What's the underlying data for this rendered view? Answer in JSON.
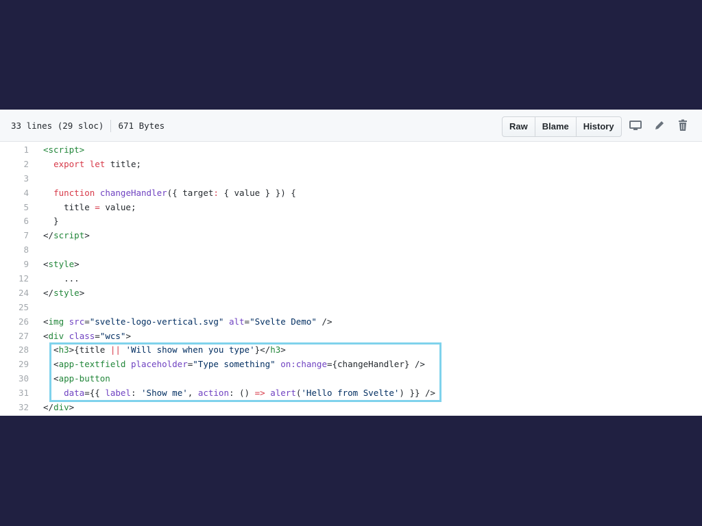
{
  "file_header": {
    "lines_info": "33 lines (29 sloc)",
    "size_info": "671 Bytes",
    "buttons": [
      "Raw",
      "Blame",
      "History"
    ],
    "icons": [
      "desktop-icon",
      "pencil-icon",
      "trash-icon"
    ]
  },
  "code_lines": [
    {
      "n": "1",
      "tokens": [
        [
          "tag",
          "<script>"
        ]
      ]
    },
    {
      "n": "2",
      "tokens": [
        [
          "plain",
          "  "
        ],
        [
          "kw",
          "export"
        ],
        [
          "plain",
          " "
        ],
        [
          "kw",
          "let"
        ],
        [
          "plain",
          " title;"
        ]
      ]
    },
    {
      "n": "3",
      "tokens": []
    },
    {
      "n": "4",
      "tokens": [
        [
          "plain",
          "  "
        ],
        [
          "kw",
          "function"
        ],
        [
          "plain",
          " "
        ],
        [
          "fn",
          "changeHandler"
        ],
        [
          "plain",
          "({ target"
        ],
        [
          "kw",
          ":"
        ],
        [
          "plain",
          " { value } }) {"
        ]
      ]
    },
    {
      "n": "5",
      "tokens": [
        [
          "plain",
          "    title "
        ],
        [
          "kw",
          "="
        ],
        [
          "plain",
          " value;"
        ]
      ]
    },
    {
      "n": "6",
      "tokens": [
        [
          "plain",
          "  }"
        ]
      ]
    },
    {
      "n": "7",
      "tokens": [
        [
          "plain",
          "</"
        ],
        [
          "tag",
          "script"
        ],
        [
          "plain",
          ">"
        ]
      ]
    },
    {
      "n": "8",
      "tokens": []
    },
    {
      "n": "9",
      "tokens": [
        [
          "plain",
          "<"
        ],
        [
          "tag",
          "style"
        ],
        [
          "plain",
          ">"
        ]
      ]
    },
    {
      "n": "12",
      "tokens": [
        [
          "plain",
          "    ..."
        ]
      ]
    },
    {
      "n": "24",
      "tokens": [
        [
          "plain",
          "</"
        ],
        [
          "tag",
          "style"
        ],
        [
          "plain",
          ">"
        ]
      ]
    },
    {
      "n": "25",
      "tokens": []
    },
    {
      "n": "26",
      "tokens": [
        [
          "plain",
          "<"
        ],
        [
          "tag",
          "img"
        ],
        [
          "plain",
          " "
        ],
        [
          "attr",
          "src"
        ],
        [
          "plain",
          "="
        ],
        [
          "str",
          "\"svelte-logo-vertical.svg\""
        ],
        [
          "plain",
          " "
        ],
        [
          "attr",
          "alt"
        ],
        [
          "plain",
          "="
        ],
        [
          "str",
          "\"Svelte Demo\""
        ],
        [
          "plain",
          " />"
        ]
      ]
    },
    {
      "n": "27",
      "tokens": [
        [
          "plain",
          "<"
        ],
        [
          "tag",
          "div"
        ],
        [
          "plain",
          " "
        ],
        [
          "attr",
          "class"
        ],
        [
          "plain",
          "="
        ],
        [
          "str",
          "\"wcs\""
        ],
        [
          "plain",
          ">"
        ]
      ]
    },
    {
      "n": "28",
      "tokens": [
        [
          "plain",
          "  <"
        ],
        [
          "tag",
          "h3"
        ],
        [
          "plain",
          ">{title "
        ],
        [
          "kw",
          "||"
        ],
        [
          "plain",
          " "
        ],
        [
          "str",
          "'Will show when you type'"
        ],
        [
          "plain",
          "}</"
        ],
        [
          "tag",
          "h3"
        ],
        [
          "plain",
          ">"
        ]
      ]
    },
    {
      "n": "29",
      "tokens": [
        [
          "plain",
          "  <"
        ],
        [
          "tag",
          "app-textfield"
        ],
        [
          "plain",
          " "
        ],
        [
          "attr",
          "placeholder"
        ],
        [
          "plain",
          "="
        ],
        [
          "str",
          "\"Type something\""
        ],
        [
          "plain",
          " "
        ],
        [
          "attr",
          "on:change"
        ],
        [
          "plain",
          "={changeHandler} />"
        ]
      ]
    },
    {
      "n": "30",
      "tokens": [
        [
          "plain",
          "  <"
        ],
        [
          "tag",
          "app-button"
        ]
      ]
    },
    {
      "n": "31",
      "tokens": [
        [
          "plain",
          "    "
        ],
        [
          "attr",
          "data"
        ],
        [
          "plain",
          "={{ "
        ],
        [
          "attr",
          "label"
        ],
        [
          "plain",
          ": "
        ],
        [
          "str",
          "'Show me'"
        ],
        [
          "plain",
          ", "
        ],
        [
          "attr",
          "action"
        ],
        [
          "plain",
          ": () "
        ],
        [
          "kw",
          "=>"
        ],
        [
          "plain",
          " "
        ],
        [
          "fn",
          "alert"
        ],
        [
          "plain",
          "("
        ],
        [
          "str",
          "'Hello from Svelte'"
        ],
        [
          "plain",
          ") }} />"
        ]
      ]
    },
    {
      "n": "32",
      "tokens": [
        [
          "plain",
          "</"
        ],
        [
          "tag",
          "div"
        ],
        [
          "plain",
          ">"
        ]
      ]
    }
  ],
  "colors": {
    "background": "#202041",
    "highlight_border": "#7fd2ec",
    "tag": "#22863a",
    "keyword": "#d73a49",
    "function": "#6f42c1",
    "string": "#032f62"
  }
}
